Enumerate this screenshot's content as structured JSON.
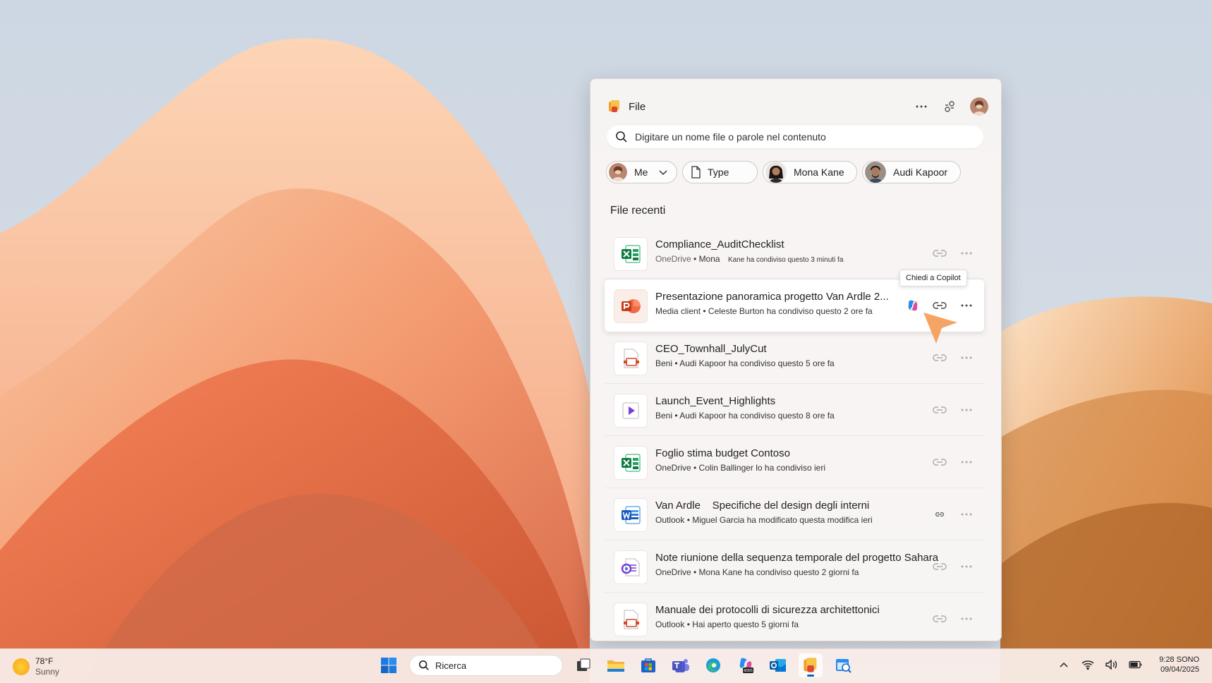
{
  "app": {
    "title": "File"
  },
  "search": {
    "placeholder": "Digitare un nome file o parole nel contenuto"
  },
  "filters": [
    {
      "label": "Me"
    },
    {
      "label": "Type"
    },
    {
      "label": "Mona Kane"
    },
    {
      "label": "Audi Kapoor"
    }
  ],
  "section_title": "File recenti",
  "tooltip": "Chiedi a Copilot",
  "files": [
    {
      "name": "Compliance_AuditChecklist",
      "sub1": "OneDrive",
      "sub2": "Mona",
      "sub3": "Kane ha condiviso questo 3 minuti fa",
      "icon": "excel-icon"
    },
    {
      "name": "Presentazione panoramica progetto Van Ardle 2...",
      "sub": "Media client • Celeste Burton ha condiviso questo 2 ore fa",
      "icon": "powerpoint-icon"
    },
    {
      "name": "CEO_Townhall_JulyCut",
      "sub": "Beni • Audi Kapoor ha condiviso questo 5 ore fa",
      "icon": "document-icon"
    },
    {
      "name": "Launch_Event_Highlights",
      "sub": "Beni • Audi Kapoor ha condiviso questo 8 ore fa",
      "icon": "video-icon"
    },
    {
      "name": "Foglio stima budget Contoso",
      "sub": "OneDrive • Colin Ballinger lo ha condiviso ieri",
      "icon": "excel-icon"
    },
    {
      "name": "Van Ardle    Specifiche del design degli interni",
      "sub": "Outlook • Miguel Garcia ha modificato questa modifica ieri",
      "icon": "word-icon"
    },
    {
      "name": "Note riunione della sequenza temporale del progetto Sahara",
      "sub": "OneDrive • Mona Kane ha condiviso questo 2 giorni fa",
      "icon": "loop-icon"
    },
    {
      "name": "Manuale dei protocolli di sicurezza architettonici",
      "sub": "Outlook • Hai aperto questo 5 giorni fa",
      "icon": "document-icon"
    }
  ],
  "taskbar": {
    "weather_temp": "78°F",
    "weather_desc": "Sunny",
    "search_label": "Ricerca",
    "time": "9:28 SONO",
    "date": "09/04/2025"
  }
}
